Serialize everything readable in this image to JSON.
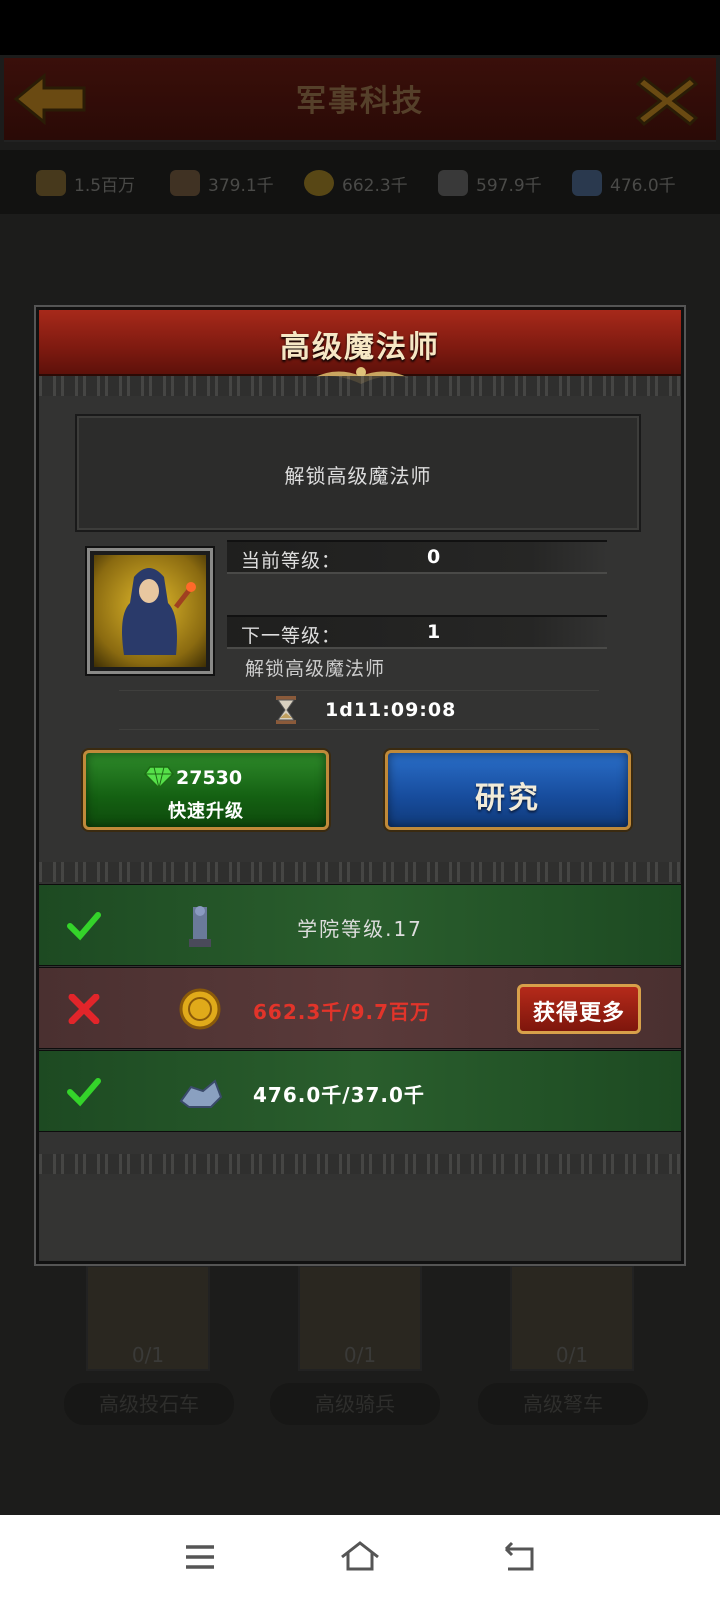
{
  "background": {
    "title": "军事科技",
    "resources": [
      {
        "icon": "wood-icon",
        "value": "1.5百万"
      },
      {
        "icon": "stone-icon",
        "value": "379.1千"
      },
      {
        "icon": "gold-coin-icon",
        "value": "662.3千"
      },
      {
        "icon": "ore-icon",
        "value": "597.9千"
      },
      {
        "icon": "mana-crystal-icon",
        "value": "476.0千"
      }
    ],
    "cards": [
      {
        "count": "0/1",
        "label": "高级投石车"
      },
      {
        "count": "0/1",
        "label": "高级骑兵"
      },
      {
        "count": "0/1",
        "label": "高级弩车"
      }
    ]
  },
  "modal": {
    "title": "高级魔法师",
    "description": "解锁高级魔法师",
    "current_level_label": "当前等级：",
    "current_level_value": "0",
    "next_level_label": "下一等级：",
    "next_level_value": "1",
    "next_level_effect": "解锁高级魔法师",
    "time": "1d11:09:08",
    "quick_upgrade": {
      "gem_cost": "27530",
      "label": "快速升级"
    },
    "research_label": "研究",
    "requirements": [
      {
        "status": "met",
        "icon": "academy-building-icon",
        "text": "学院等级.17"
      },
      {
        "status": "unmet",
        "icon": "gold-coin-icon",
        "text": "662.3千/9.7百万",
        "action": "获得更多"
      },
      {
        "status": "met",
        "icon": "mana-crystal-icon",
        "text": "476.0千/37.0千"
      }
    ]
  },
  "colors": {
    "accent_red": "#a7291a",
    "ok_green": "#2a5e2d",
    "error_red": "#e2342a",
    "button_blue": "#174c9c",
    "button_green": "#146012"
  },
  "navbar": {
    "icons": [
      "menu-icon",
      "home-icon",
      "back-icon"
    ]
  }
}
